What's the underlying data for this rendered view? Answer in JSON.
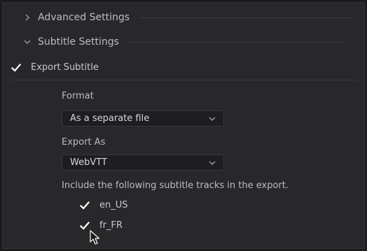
{
  "sections": {
    "advanced": {
      "title": "Advanced Settings",
      "expanded": false,
      "icon": "chevron-right-icon"
    },
    "subtitle": {
      "title": "Subtitle Settings",
      "expanded": true,
      "icon": "chevron-down-icon"
    }
  },
  "export_subtitle": {
    "label": "Export Subtitle",
    "checked": true
  },
  "format": {
    "label": "Format",
    "selected": "As a separate file"
  },
  "export_as": {
    "label": "Export As",
    "selected": "WebVTT"
  },
  "tracks": {
    "instruction": "Include the following subtitle tracks in the export.",
    "items": [
      {
        "label": "en_US",
        "checked": true
      },
      {
        "label": "fr_FR",
        "checked": true
      }
    ]
  },
  "colors": {
    "background": "#28282b",
    "text": "#c9c9cb",
    "dropdown_bg": "#1e1e20",
    "checkmark": "#ffffff"
  }
}
